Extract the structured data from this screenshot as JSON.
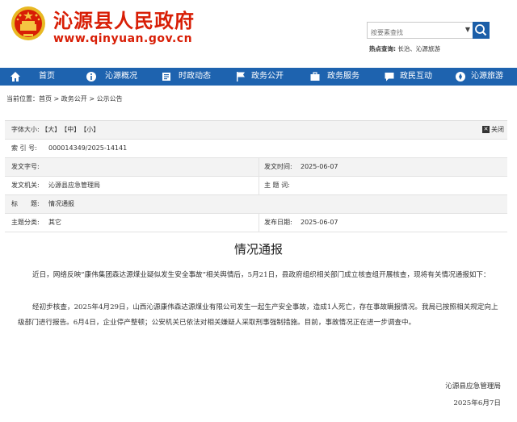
{
  "header": {
    "site_title": "沁源县人民政府",
    "site_domain": "www.qinyuan.gov.cn",
    "search_placeholder": "按要素查找",
    "hot_label": "热点查询:",
    "hot_links": "长治、沁源旅游",
    "brand_color": "#d81e06"
  },
  "nav": {
    "color": "#1e63af",
    "items": [
      {
        "label": "首页",
        "icon": "home-icon"
      },
      {
        "label": "沁源概况",
        "icon": "info-icon"
      },
      {
        "label": "时政动态",
        "icon": "news-icon"
      },
      {
        "label": "政务公开",
        "icon": "flag-icon"
      },
      {
        "label": "政务服务",
        "icon": "briefcase-icon"
      },
      {
        "label": "政民互动",
        "icon": "chat-icon"
      },
      {
        "label": "沁源旅游",
        "icon": "travel-icon"
      }
    ]
  },
  "breadcrumb": "当前位置：首页 > 政务公开 > 公示公告",
  "info": {
    "font_size_label": "字体大小:",
    "font_big": "【大】",
    "font_mid": "【中】",
    "font_small": "【小】",
    "close_label": "关闭",
    "index_label": "索 引 号:",
    "index_value": "000014349/2025-14141",
    "doc_no_label": "发文字号:",
    "doc_no_value": "",
    "doc_time_label": "发文时间:",
    "doc_time_value": "2025-06-07",
    "issuer_label": "发文机关:",
    "issuer_value": "沁源县应急管理局",
    "subject_label": "主 题 词:",
    "subject_value": "",
    "title_label": "标　　题:",
    "title_value": "情况通报",
    "category_label": "主题分类:",
    "category_value": "其它",
    "pub_date_label": "发布日期:",
    "pub_date_value": "2025-06-07"
  },
  "article": {
    "title": "情况通报",
    "paragraph1": "近日，网络反映“康伟集团森达源煤业疑似发生安全事故”相关舆情后，5月21日，县政府组织相关部门成立核查组开展核查，现将有关情况通报如下：",
    "paragraph2": "经初步核查，2025年4月29日，山西沁源康伟森达源煤业有限公司发生一起生产安全事故，造成1人死亡，存在事故瞒报情况。我局已按照相关规定向上级部门进行报告。6月4日，企业停产整顿；公安机关已依法对相关嫌疑人采取刑事强制措施。目前，事故情况正在进一步调查中。",
    "signature": "沁源县应急管理局",
    "date": "2025年6月7日"
  }
}
